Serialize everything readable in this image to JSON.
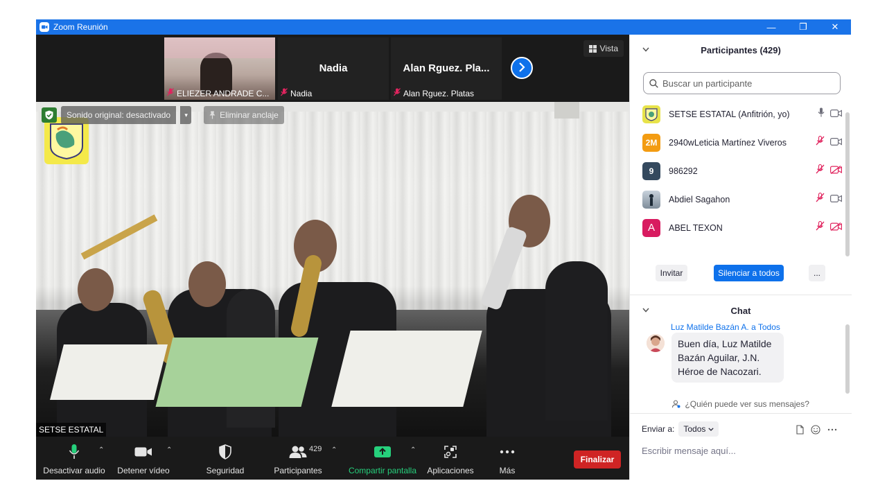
{
  "window": {
    "title": "Zoom Reunión",
    "controls": [
      "—",
      "❐",
      "✕"
    ]
  },
  "strip": {
    "tiles": [
      {
        "name": "",
        "label": "ELIEZER ANDRADE C..."
      },
      {
        "name": "Nadia",
        "label": "Nadia"
      },
      {
        "name": "Alan  Rguez. Pla...",
        "label": "Alan  Rguez. Platas"
      }
    ],
    "view_label": "Vista"
  },
  "main_video": {
    "audio_label": "Sonido original: desactivado",
    "unpin_label": "Eliminar anclaje",
    "speaker_name": "SETSE ESTATAL"
  },
  "toolbar": {
    "audio": "Desactivar audio",
    "video": "Detener vídeo",
    "security": "Seguridad",
    "participants": "Participantes",
    "participants_count": "429",
    "share": "Compartir pantalla",
    "apps": "Aplicaciones",
    "more": "Más",
    "end": "Finalizar"
  },
  "participants_panel": {
    "title": "Participantes (429)",
    "search_placeholder": "Buscar un participante",
    "items": [
      {
        "avatar_text": "",
        "avatar_color": "#d4d040",
        "name": "SETSE ESTATAL (Anfitrión, yo)",
        "muted": false,
        "video_off": false
      },
      {
        "avatar_text": "2M",
        "avatar_color": "#f39c12",
        "name": "2940wLeticia Martínez Viveros",
        "muted": true,
        "video_off": false
      },
      {
        "avatar_text": "9",
        "avatar_color": "#34495e",
        "name": "986292",
        "muted": true,
        "video_off": true
      },
      {
        "avatar_text": "",
        "avatar_color": "#8fa3b8",
        "name": "Abdiel Sagahon",
        "muted": true,
        "video_off": false
      },
      {
        "avatar_text": "A",
        "avatar_color": "#d81b60",
        "name": "ABEL TEXON",
        "muted": true,
        "video_off": true
      }
    ],
    "invite_label": "Invitar",
    "mute_all_label": "Silenciar a todos",
    "more_label": "..."
  },
  "chat": {
    "title": "Chat",
    "sender": "Luz Matilde Bazán A. a Todos",
    "message": "Buen día, Luz Matilde Bazán Aguilar, J.N. Héroe de Nacozari.",
    "who_can_see": "¿Quién puede ver sus mensajes?",
    "send_to_label": "Enviar a:",
    "send_to_value": "Todos",
    "input_placeholder": "Escribir mensaje aquí..."
  },
  "colors": {
    "accent": "#0e71eb",
    "title_bar": "#1a73e8",
    "end_button": "#cf2424",
    "share_green": "#26d07c",
    "muted_red": "#e0245e"
  }
}
